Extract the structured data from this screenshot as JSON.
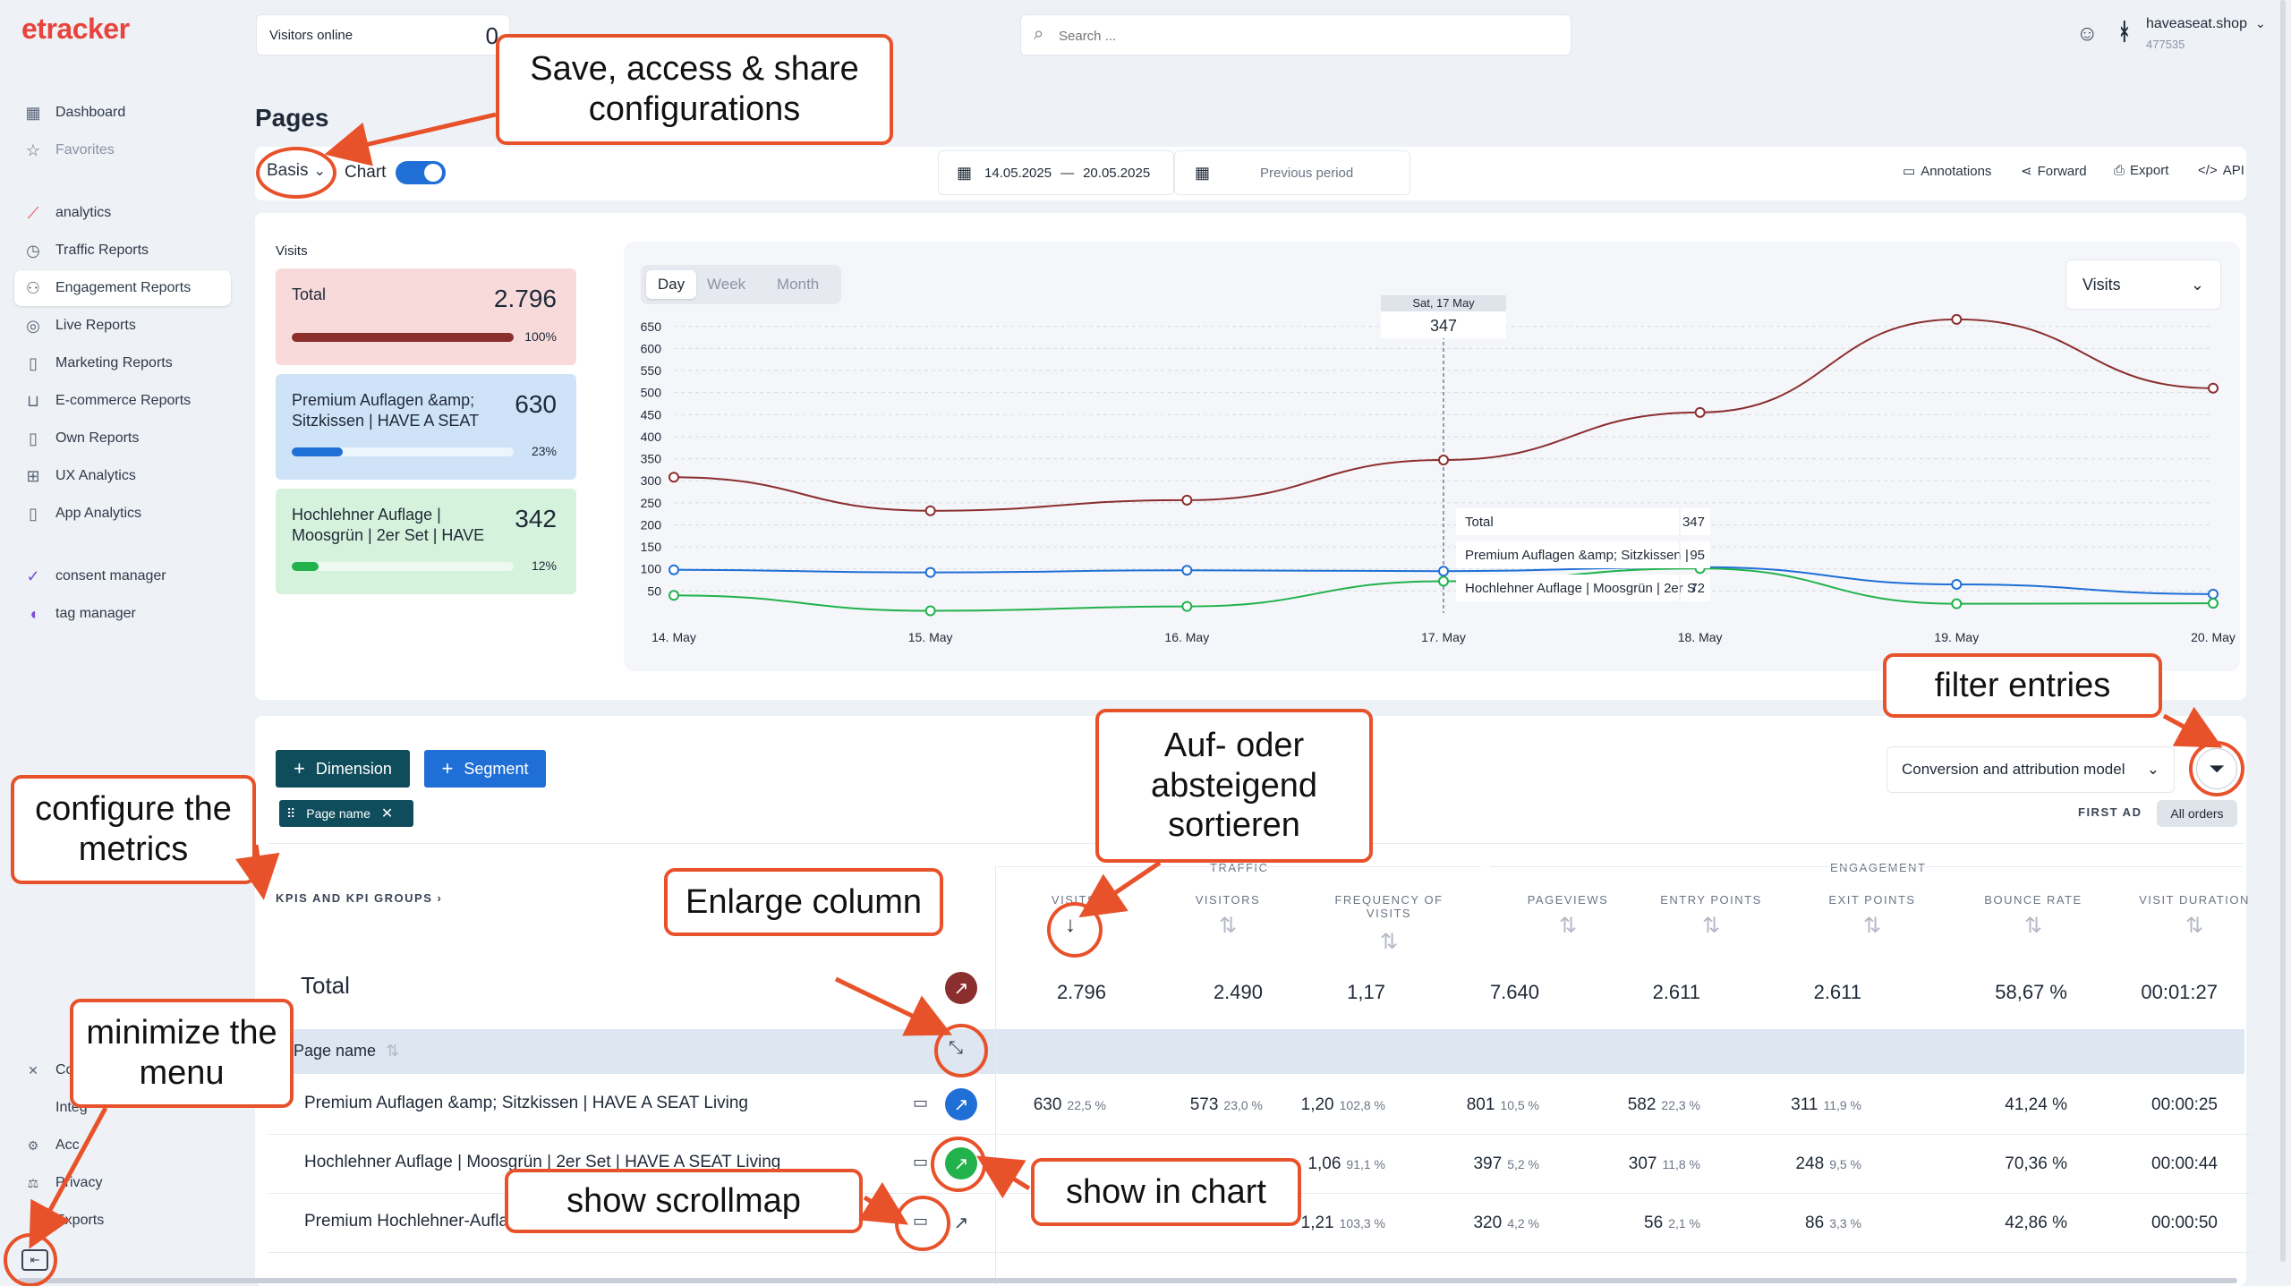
{
  "app": {
    "logo": "etracker"
  },
  "sidebar": {
    "items": [
      {
        "label": "Dashboard",
        "icon": "dashboard-icon"
      },
      {
        "label": "Favorites",
        "icon": "star-icon"
      },
      {
        "label": "analytics",
        "icon": "analytics-icon"
      },
      {
        "label": "Traffic Reports",
        "icon": "traffic-icon"
      },
      {
        "label": "Engagement Reports",
        "icon": "users-icon"
      },
      {
        "label": "Live Reports",
        "icon": "live-icon"
      },
      {
        "label": "Marketing Reports",
        "icon": "document-icon"
      },
      {
        "label": "E-commerce Reports",
        "icon": "cart-icon"
      },
      {
        "label": "Own Reports",
        "icon": "document-icon"
      },
      {
        "label": "UX Analytics",
        "icon": "ux-icon"
      },
      {
        "label": "App Analytics",
        "icon": "phone-icon"
      },
      {
        "label": "consent manager",
        "icon": "consent-icon"
      },
      {
        "label": "tag manager",
        "icon": "tag-icon"
      }
    ],
    "bottom": [
      {
        "label": "Co",
        "icon": "tools-icon"
      },
      {
        "label": "Integ",
        "icon": "code-icon"
      },
      {
        "label": "Acc",
        "icon": "gear-icon"
      },
      {
        "label": "Privacy",
        "icon": "scale-icon"
      },
      {
        "label": "Exports",
        "icon": "document-icon"
      }
    ]
  },
  "header": {
    "visitors_online_label": "Visitors online",
    "visitors_online_value": "0",
    "search_placeholder": "Search ...",
    "account_name": "haveaseat.shop",
    "account_id": "477535"
  },
  "page": {
    "title": "Pages",
    "config_label": "Basis",
    "chart_toggle_label": "Chart",
    "date_from": "14.05.2025",
    "date_sep": "—",
    "date_to": "20.05.2025",
    "compare_label": "Previous period",
    "actions": [
      "Annotations",
      "Forward",
      "Export",
      "API"
    ]
  },
  "kpi_panel": {
    "title": "Visits",
    "cards": [
      {
        "label": "Total",
        "value": "2.796",
        "pct": "100%",
        "fraction": 1.0,
        "color": "#8b2e2e",
        "bg": "#f8dada"
      },
      {
        "label": "Premium Auflagen &amp; Sitzkissen | HAVE A SEAT",
        "value": "630",
        "pct": "23%",
        "fraction": 0.23,
        "color": "#1f6fd6",
        "bg": "#cfe3f8"
      },
      {
        "label": "Hochlehner Auflage | Moosgrün | 2er Set | HAVE",
        "value": "342",
        "pct": "12%",
        "fraction": 0.12,
        "color": "#22b24c",
        "bg": "#d5f2dc"
      }
    ]
  },
  "chart_controls": {
    "granularity": [
      "Day",
      "Week",
      "Month"
    ],
    "active": "Day",
    "metric_select": "Visits"
  },
  "chart_data": {
    "type": "line",
    "x": [
      "14. May",
      "15. May",
      "16. May",
      "17. May",
      "18. May",
      "19. May",
      "20. May"
    ],
    "y_ticks": [
      50,
      100,
      150,
      200,
      250,
      300,
      350,
      400,
      450,
      500,
      550,
      600,
      650
    ],
    "ylim": [
      0,
      680
    ],
    "grid": true,
    "series": [
      {
        "name": "Total",
        "color": "#8b2e2e",
        "values": [
          308,
          232,
          256,
          347,
          455,
          666,
          510
        ]
      },
      {
        "name": "Premium Auflagen &amp; Sitzkissen |",
        "color": "#1f6fd6",
        "values": [
          98,
          92,
          97,
          95,
          104,
          65,
          43
        ]
      },
      {
        "name": "Hochlehner Auflage | Moosgrün | 2er S",
        "color": "#22b24c",
        "values": [
          40,
          5,
          15,
          72,
          101,
          21,
          22
        ]
      }
    ],
    "tooltip": {
      "date": "Sat, 17 May",
      "value": "347",
      "rows": [
        {
          "label": "Total",
          "value": "347"
        },
        {
          "label": "Premium Auflagen &amp; Sitzkissen |",
          "value": "95"
        },
        {
          "label": "Hochlehner Auflage | Moosgrün | 2er S",
          "value": "72"
        }
      ]
    }
  },
  "table": {
    "dimension_btn": "Dimension",
    "segment_btn": "Segment",
    "chip": "Page name",
    "model_select": "Conversion and attribution model",
    "first_ad": "FIRST AD",
    "all_orders": "All orders",
    "kpi_groups": "KPIS AND KPI GROUPS",
    "group_traffic": "TRAFFIC",
    "group_engagement": "ENGAGEMENT",
    "columns": [
      "VISITS",
      "VISITORS",
      "FREQUENCY OF VISITS",
      "PAGEVIEWS",
      "ENTRY POINTS",
      "EXIT POINTS",
      "BOUNCE RATE",
      "VISIT DURATION"
    ],
    "total_label": "Total",
    "total": [
      "2.796",
      "2.490",
      "1,17",
      "7.640",
      "2.611",
      "2.611",
      "58,67 %",
      "00:01:27"
    ],
    "page_name_header": "Page name",
    "rows": [
      {
        "name": "Premium Auflagen &amp; Sitzkissen | HAVE A SEAT Living",
        "cells": [
          [
            "630",
            "22,5 %"
          ],
          [
            "573",
            "23,0 %"
          ],
          [
            "1,20",
            "102,8 %"
          ],
          [
            "801",
            "10,5 %"
          ],
          [
            "582",
            "22,3 %"
          ],
          [
            "311",
            "11,9 %"
          ],
          [
            "41,24 %",
            ""
          ],
          [
            "00:00:25",
            ""
          ]
        ]
      },
      {
        "name": "Hochlehner Auflage | Moosgrün | 2er Set | HAVE A SEAT Living",
        "cells": [
          [
            "",
            ""
          ],
          [
            "",
            ""
          ],
          [
            "1,06",
            "91,1 %"
          ],
          [
            "397",
            "5,2 %"
          ],
          [
            "307",
            "11,8 %"
          ],
          [
            "248",
            "9,5 %"
          ],
          [
            "70,36 %",
            ""
          ],
          [
            "00:00:44",
            ""
          ]
        ]
      },
      {
        "name": "Premium Hochlehner-Aufla",
        "cells": [
          [
            "",
            ""
          ],
          [
            "",
            ""
          ],
          [
            "1,21",
            "103,3 %"
          ],
          [
            "320",
            "4,2 %"
          ],
          [
            "56",
            "2,1 %"
          ],
          [
            "86",
            "3,3 %"
          ],
          [
            "42,86 %",
            ""
          ],
          [
            "00:00:50",
            ""
          ]
        ]
      }
    ]
  },
  "callouts": {
    "save": "Save, access & share configurations",
    "filter": "filter entries",
    "sort": "Auf- oder absteigend sortieren",
    "metrics": "configure the metrics",
    "enlarge": "Enlarge column",
    "minimize": "minimize the menu",
    "scrollmap": "show scrollmap",
    "chart": "show in chart"
  }
}
